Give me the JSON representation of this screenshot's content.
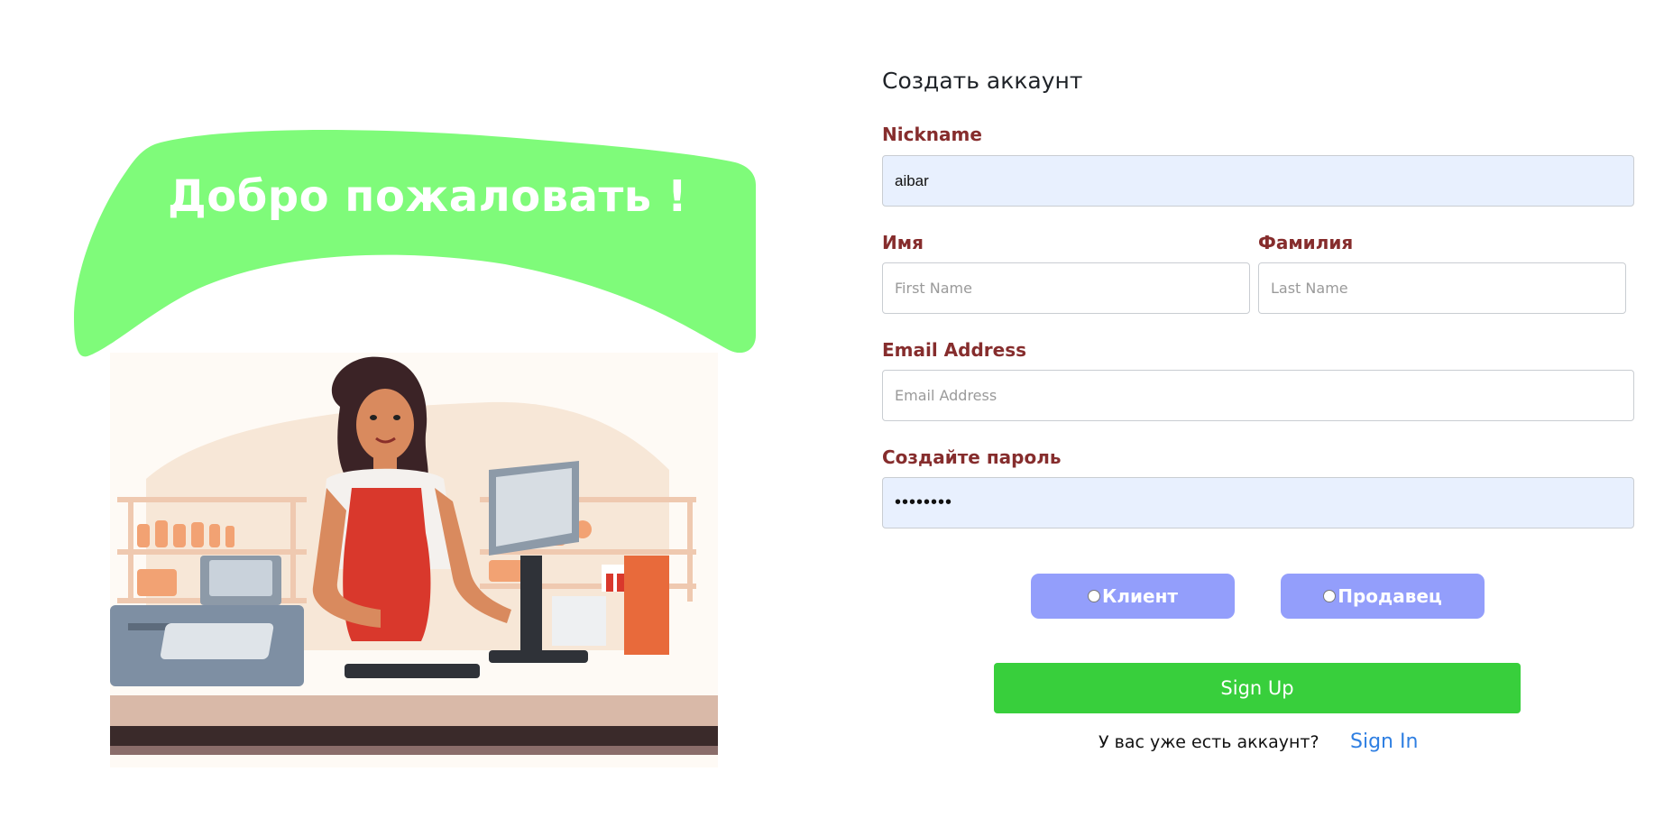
{
  "hero": {
    "welcome_text": "Добро пожаловать !"
  },
  "form": {
    "title": "Создать аккаунт",
    "nickname": {
      "label": "Nickname",
      "value": "aibar"
    },
    "first_name": {
      "label": "Имя",
      "placeholder": "First Name",
      "value": ""
    },
    "last_name": {
      "label": "Фамилия",
      "placeholder": "Last Name",
      "value": ""
    },
    "email": {
      "label": "Email Address",
      "placeholder": "Email Address",
      "value": ""
    },
    "password": {
      "label": "Создайте пароль",
      "value": "••••••••"
    },
    "roles": [
      {
        "label": "Клиент",
        "selected": false
      },
      {
        "label": "Продавец",
        "selected": false
      }
    ],
    "submit_label": "Sign Up",
    "signin_prompt": "У вас уже есть аккаунт?",
    "signin_link": "Sign In"
  },
  "colors": {
    "blob_green": "#7ffb7a",
    "label_color": "#862d2d",
    "role_button": "#939efb",
    "signup_button": "#38cf3c",
    "link_blue": "#2f7fe2",
    "autofill_bg": "#e8f0fe"
  }
}
